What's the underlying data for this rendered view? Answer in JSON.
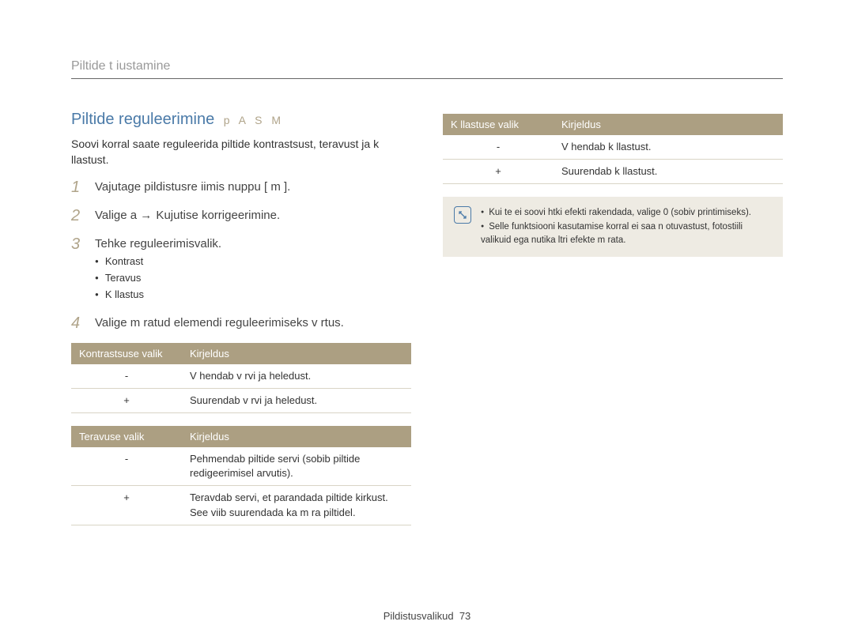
{
  "section_title": "Piltide t iustamine",
  "heading": {
    "title": "Piltide reguleerimine",
    "modes": "p A S M"
  },
  "intro": "Soovi korral saate reguleerida piltide kontrastsust, teravust ja k llastust.",
  "steps": [
    {
      "num": "1",
      "text": "Vajutage pildistusre iimis nuppu [ m         ]."
    },
    {
      "num": "2",
      "text_prefix": "Valige a     ",
      "arrow": "→",
      "text_suffix": " Kujutise korrigeerimine."
    },
    {
      "num": "3",
      "text": "Tehke reguleerimisvalik.",
      "bullets": [
        "Kontrast",
        "Teravus",
        "K llastus"
      ]
    },
    {
      "num": "4",
      "text": "Valige m  ratud elemendi reguleerimiseks v  rtus."
    }
  ],
  "tables": {
    "contrast": {
      "header": [
        "Kontrastsuse valik",
        "Kirjeldus"
      ],
      "rows": [
        {
          "k": "-",
          "v": "V hendab v rvi ja heledust."
        },
        {
          "k": "+",
          "v": "Suurendab v rvi ja heledust."
        }
      ]
    },
    "sharpness": {
      "header": [
        "Teravuse valik",
        "Kirjeldus"
      ],
      "rows": [
        {
          "k": "-",
          "v": "Pehmendab piltide servi (sobib piltide redigeerimisel arvutis)."
        },
        {
          "k": "+",
          "v": "Teravdab servi, et parandada piltide kirkust. See viib suurendada ka m ra piltidel."
        }
      ]
    },
    "saturation": {
      "header": [
        "K llastuse valik",
        "Kirjeldus"
      ],
      "rows": [
        {
          "k": "-",
          "v": "V hendab k llastust."
        },
        {
          "k": "+",
          "v": "Suurendab k llastust."
        }
      ]
    }
  },
  "notes": [
    "Kui te ei soovi  htki efekti rakendada, valige  0  (sobiv printimiseks).",
    "Selle funktsiooni kasutamise korral ei saa n otuvastust, fotostiili valikuid ega nutika  ltri efekte m  rata."
  ],
  "footer": {
    "label": "Pildistusvalikud",
    "page": "73"
  }
}
